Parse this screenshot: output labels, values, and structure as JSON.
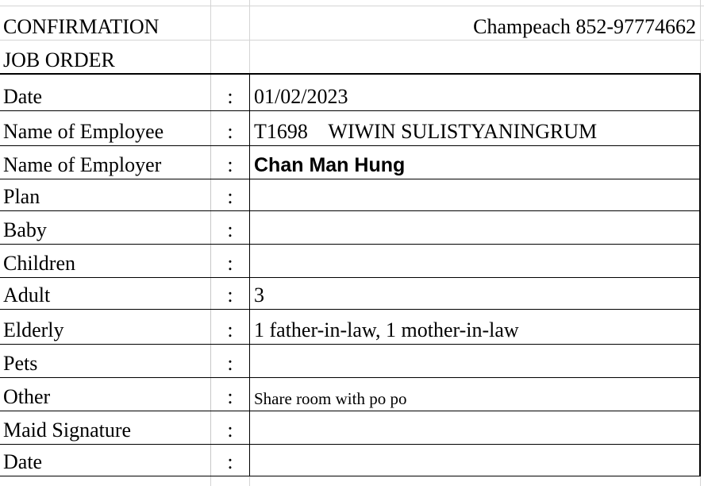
{
  "header": {
    "title_line1": "CONFIRMATION",
    "title_line2": "JOB ORDER",
    "company_contact": "Champeach  852-97774662"
  },
  "rows": [
    {
      "label": "Date",
      "colon": ":",
      "value": "01/02/2023"
    },
    {
      "label": "Name of Employee",
      "colon": ":",
      "value": "T1698    WIWIN SULISTYANINGRUM"
    },
    {
      "label": "Name of Employer",
      "colon": ":",
      "value": "Chan Man Hung"
    },
    {
      "label": "Plan",
      "colon": ":",
      "value": ""
    },
    {
      "label": "Baby",
      "colon": ":",
      "value": ""
    },
    {
      "label": "Children",
      "colon": ":",
      "value": ""
    },
    {
      "label": "Adult",
      "colon": ":",
      "value": "3"
    },
    {
      "label": "Elderly",
      "colon": ":",
      "value": "1 father-in-law, 1 mother-in-law"
    },
    {
      "label": "Pets",
      "colon": ":",
      "value": ""
    },
    {
      "label": "Other",
      "colon": ":",
      "value": "Share room with po po"
    },
    {
      "label": "Maid Signature",
      "colon": ":",
      "value": ""
    },
    {
      "label": "Date",
      "colon": ":",
      "value": ""
    }
  ]
}
